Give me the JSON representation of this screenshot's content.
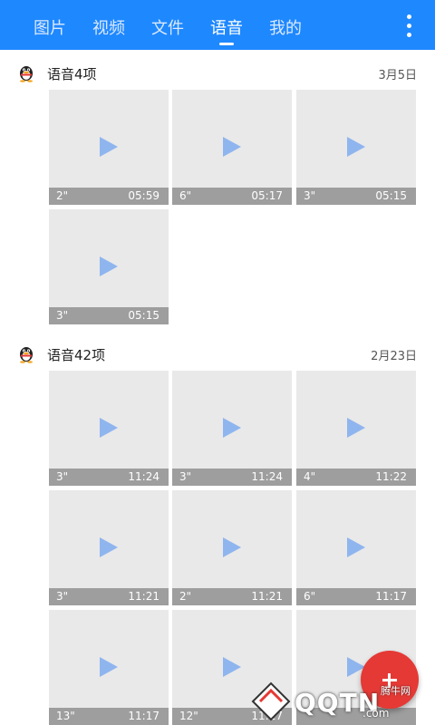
{
  "tabs": [
    {
      "label": "图片"
    },
    {
      "label": "视频"
    },
    {
      "label": "文件"
    },
    {
      "label": "语音"
    },
    {
      "label": "我的"
    }
  ],
  "active_tab": "语音",
  "icons": {
    "more": "more-vert-icon",
    "qq": "qq-penguin-icon",
    "play": "play-icon",
    "fab": "plus-icon"
  },
  "colors": {
    "topbar": "#1e88ff",
    "fab": "#e53935",
    "play": "#8fb5ef",
    "footer": "#9e9e9e"
  },
  "sections": [
    {
      "title": "语音4项",
      "date": "3月5日",
      "items": [
        {
          "duration": "2\"",
          "time": "05:59"
        },
        {
          "duration": "6\"",
          "time": "05:17"
        },
        {
          "duration": "3\"",
          "time": "05:15"
        },
        {
          "duration": "3\"",
          "time": "05:15"
        }
      ]
    },
    {
      "title": "语音42项",
      "date": "2月23日",
      "items": [
        {
          "duration": "3\"",
          "time": "11:24"
        },
        {
          "duration": "3\"",
          "time": "11:24"
        },
        {
          "duration": "4\"",
          "time": "11:22"
        },
        {
          "duration": "3\"",
          "time": "11:21"
        },
        {
          "duration": "2\"",
          "time": "11:21"
        },
        {
          "duration": "6\"",
          "time": "11:17"
        },
        {
          "duration": "13\"",
          "time": "11:17"
        },
        {
          "duration": "12\"",
          "time": "11:17"
        }
      ]
    }
  ],
  "watermark": {
    "brand": "QQTN",
    "suffix": ".com",
    "small": "腾牛网"
  }
}
